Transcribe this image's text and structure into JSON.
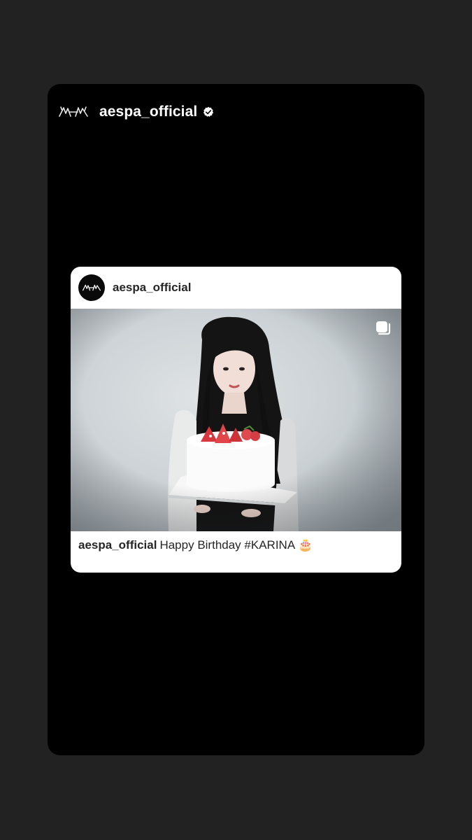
{
  "story": {
    "username": "aespa_official",
    "verified": true,
    "logo_icon": "aespa-logo-icon",
    "badge_icon": "verified-badge-icon"
  },
  "post": {
    "username": "aespa_official",
    "avatar_icon": "aespa-logo-icon",
    "carousel_icon": "multiple-photos-icon",
    "caption": {
      "username": "aespa_official",
      "text": "Happy Birthday #KARINA",
      "emoji": "🎂"
    }
  },
  "colors": {
    "app_background": "#222222",
    "story_background": "#000000",
    "card_background": "#ffffff",
    "text_dark": "#262626"
  }
}
